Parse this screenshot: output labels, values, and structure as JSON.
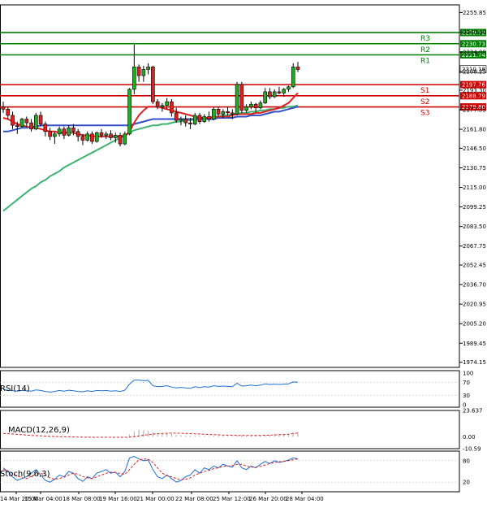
{
  "chart_data": {
    "type": "candlestick",
    "price_ticks": [
      "2255.85",
      "2240.10",
      "2224.00",
      "2208.25",
      "2193.30",
      "2177.55",
      "2161.80",
      "2146.50",
      "2130.75",
      "2115.00",
      "2099.25",
      "2083.50",
      "2067.75",
      "2052.45",
      "2036.70",
      "2020.95",
      "2005.20",
      "1989.45",
      "1974.15"
    ],
    "price_range": [
      1970,
      2262
    ],
    "x_labels": [
      "14 Mar 20:00",
      "15 Mar 04:00",
      "18 Mar 08:00",
      "19 Mar 16:00",
      "21 Mar 00:00",
      "22 Mar 08:00",
      "25 Mar 12:00",
      "26 Mar 20:00",
      "28 Mar 04:00"
    ],
    "levels": [
      {
        "name": "R3",
        "value": "2239.72",
        "color": "#008000"
      },
      {
        "name": "R2",
        "value": "2230.73",
        "color": "#008000"
      },
      {
        "name": "R1",
        "value": "2221.74",
        "color": "#008000"
      },
      {
        "name": "S1",
        "value": "2197.76",
        "color": "#cc0000"
      },
      {
        "name": "S2",
        "value": "2188.79",
        "color": "#cc0000"
      },
      {
        "name": "S3",
        "value": "2179.80",
        "color": "#cc0000"
      }
    ],
    "current_price": "2210.18",
    "candles": [
      [
        2180,
        2184,
        2175,
        2178
      ],
      [
        2178,
        2180,
        2170,
        2173
      ],
      [
        2173,
        2176,
        2162,
        2165
      ],
      [
        2165,
        2168,
        2158,
        2164
      ],
      [
        2164,
        2171,
        2163,
        2170
      ],
      [
        2170,
        2172,
        2164,
        2167
      ],
      [
        2167,
        2170,
        2160,
        2162
      ],
      [
        2162,
        2175,
        2161,
        2173
      ],
      [
        2173,
        2176,
        2164,
        2166
      ],
      [
        2166,
        2168,
        2156,
        2160
      ],
      [
        2160,
        2163,
        2153,
        2156
      ],
      [
        2156,
        2160,
        2150,
        2158
      ],
      [
        2158,
        2164,
        2156,
        2162
      ],
      [
        2162,
        2164,
        2154,
        2157
      ],
      [
        2157,
        2165,
        2156,
        2163
      ],
      [
        2163,
        2166,
        2157,
        2160
      ],
      [
        2160,
        2162,
        2152,
        2156
      ],
      [
        2156,
        2158,
        2149,
        2153
      ],
      [
        2153,
        2160,
        2152,
        2158
      ],
      [
        2158,
        2160,
        2150,
        2152
      ],
      [
        2152,
        2160,
        2151,
        2159
      ],
      [
        2159,
        2162,
        2155,
        2157
      ],
      [
        2157,
        2160,
        2154,
        2158
      ],
      [
        2158,
        2161,
        2153,
        2155
      ],
      [
        2155,
        2159,
        2151,
        2157
      ],
      [
        2157,
        2159,
        2148,
        2150
      ],
      [
        2150,
        2160,
        2149,
        2158
      ],
      [
        2158,
        2195,
        2157,
        2194
      ],
      [
        2194,
        2230,
        2190,
        2212
      ],
      [
        2212,
        2214,
        2200,
        2205
      ],
      [
        2205,
        2213,
        2200,
        2210
      ],
      [
        2210,
        2215,
        2206,
        2212
      ],
      [
        2212,
        2213,
        2182,
        2184
      ],
      [
        2184,
        2186,
        2178,
        2180
      ],
      [
        2180,
        2183,
        2176,
        2181
      ],
      [
        2181,
        2187,
        2178,
        2184
      ],
      [
        2184,
        2186,
        2172,
        2175
      ],
      [
        2175,
        2179,
        2167,
        2169
      ],
      [
        2169,
        2172,
        2165,
        2170
      ],
      [
        2170,
        2173,
        2164,
        2167
      ],
      [
        2167,
        2171,
        2162,
        2166
      ],
      [
        2166,
        2175,
        2165,
        2173
      ],
      [
        2173,
        2175,
        2166,
        2168
      ],
      [
        2168,
        2174,
        2167,
        2172
      ],
      [
        2172,
        2176,
        2168,
        2170
      ],
      [
        2170,
        2180,
        2169,
        2178
      ],
      [
        2178,
        2180,
        2172,
        2174
      ],
      [
        2174,
        2178,
        2171,
        2176
      ],
      [
        2176,
        2180,
        2173,
        2175
      ],
      [
        2175,
        2178,
        2170,
        2174
      ],
      [
        2174,
        2200,
        2173,
        2198
      ],
      [
        2198,
        2200,
        2175,
        2177
      ],
      [
        2177,
        2182,
        2175,
        2180
      ],
      [
        2180,
        2184,
        2178,
        2182
      ],
      [
        2182,
        2183,
        2176,
        2179
      ],
      [
        2179,
        2185,
        2178,
        2183
      ],
      [
        2183,
        2195,
        2182,
        2192
      ],
      [
        2192,
        2195,
        2186,
        2188
      ],
      [
        2188,
        2194,
        2187,
        2192
      ],
      [
        2192,
        2196,
        2190,
        2191
      ],
      [
        2191,
        2195,
        2188,
        2194
      ],
      [
        2194,
        2197,
        2192,
        2196
      ],
      [
        2196,
        2215,
        2195,
        2212
      ],
      [
        2212,
        2216,
        2208,
        2210
      ]
    ],
    "ma_fast": [
      2171,
      2170,
      2168,
      2166,
      2165,
      2164,
      2163,
      2163,
      2162,
      2161,
      2160,
      2160,
      2159,
      2159,
      2159,
      2159,
      2158,
      2157,
      2157,
      2156,
      2156,
      2156,
      2156,
      2156,
      2156,
      2156,
      2156,
      2160,
      2167,
      2173,
      2177,
      2180,
      2180,
      2180,
      2179,
      2178,
      2177,
      2176,
      2175,
      2174,
      2173,
      2172,
      2171,
      2171,
      2171,
      2172,
      2172,
      2172,
      2172,
      2173,
      2174,
      2174,
      2174,
      2174,
      2175,
      2175,
      2176,
      2177,
      2178,
      2179,
      2181,
      2183,
      2187,
      2191
    ],
    "ma_mid": [
      2160,
      2160,
      2161,
      2162,
      2163,
      2163,
      2164,
      2164,
      2165,
      2165,
      2165,
      2165,
      2165,
      2165,
      2165,
      2165,
      2165,
      2165,
      2165,
      2165,
      2165,
      2165,
      2165,
      2165,
      2165,
      2165,
      2165,
      2165,
      2166,
      2167,
      2168,
      2169,
      2170,
      2170,
      2170,
      2170,
      2170,
      2170,
      2170,
      2170,
      2170,
      2170,
      2170,
      2170,
      2170,
      2170,
      2171,
      2171,
      2171,
      2171,
      2172,
      2172,
      2172,
      2173,
      2173,
      2173,
      2174,
      2175,
      2176,
      2176,
      2177,
      2178,
      2179,
      2180
    ],
    "ma_slow": [
      2096,
      2099,
      2102,
      2105,
      2108,
      2111,
      2114,
      2116,
      2119,
      2121,
      2124,
      2126,
      2128,
      2131,
      2133,
      2135,
      2137,
      2139,
      2141,
      2143,
      2145,
      2147,
      2149,
      2151,
      2153,
      2155,
      2157,
      2159,
      2161,
      2162,
      2163,
      2164,
      2165,
      2165,
      2166,
      2166,
      2167,
      2168,
      2168,
      2169,
      2169,
      2170,
      2170,
      2171,
      2171,
      2172,
      2172,
      2173,
      2173,
      2174,
      2174,
      2175,
      2175,
      2176,
      2176,
      2177,
      2177,
      2178,
      2178,
      2179,
      2179,
      2180,
      2180,
      2181
    ],
    "rsi": {
      "label": "RSI(14)",
      "ticks": [
        "100",
        "70",
        "30",
        "0"
      ],
      "values": [
        48,
        46,
        44,
        43,
        45,
        44,
        43,
        47,
        45,
        42,
        40,
        42,
        45,
        43,
        46,
        44,
        42,
        41,
        44,
        42,
        45,
        44,
        45,
        43,
        44,
        42,
        46,
        65,
        78,
        78,
        76,
        77,
        60,
        57,
        58,
        60,
        56,
        53,
        55,
        53,
        52,
        57,
        54,
        57,
        56,
        60,
        58,
        59,
        58,
        57,
        68,
        59,
        60,
        62,
        60,
        62,
        66,
        64,
        65,
        64,
        65,
        66,
        72,
        71
      ]
    },
    "macd": {
      "label": "MACD(12,26,9)",
      "ticks": [
        "23.637",
        "0.00",
        "-10.59"
      ],
      "histogram": [
        0.5,
        0.3,
        0.1,
        -0.1,
        -0.2,
        -0.3,
        -0.3,
        -0.2,
        -0.2,
        -0.3,
        -0.4,
        -0.4,
        -0.3,
        -0.3,
        -0.2,
        -0.2,
        -0.3,
        -0.4,
        -0.3,
        -0.3,
        -0.2,
        -0.2,
        -0.2,
        -0.2,
        -0.2,
        -0.3,
        -0.2,
        2,
        5,
        6.5,
        6,
        5.5,
        4,
        3.5,
        3,
        3,
        2.5,
        2,
        1.5,
        1.2,
        1,
        1,
        0.8,
        0.8,
        0.7,
        0.9,
        0.8,
        0.8,
        0.7,
        0.7,
        1.5,
        1.3,
        1.2,
        1.3,
        1.2,
        1.4,
        2,
        2.2,
        2.4,
        2.5,
        2.6,
        2.8,
        4,
        4.4
      ],
      "signal": [
        3,
        2.8,
        2.5,
        2.2,
        1.9,
        1.6,
        1.3,
        1.1,
        0.9,
        0.7,
        0.5,
        0.3,
        0.2,
        0.1,
        0,
        -0.1,
        -0.2,
        -0.3,
        -0.3,
        -0.4,
        -0.4,
        -0.4,
        -0.4,
        -0.4,
        -0.4,
        -0.4,
        -0.4,
        -0.3,
        0.2,
        0.8,
        1.4,
        1.9,
        2.4,
        2.8,
        3,
        3.2,
        3.3,
        3.3,
        3.2,
        3.1,
        2.9,
        2.7,
        2.5,
        2.3,
        2.1,
        1.9,
        1.8,
        1.6,
        1.5,
        1.4,
        1.3,
        1.3,
        1.2,
        1.2,
        1.2,
        1.3,
        1.4,
        1.5,
        1.7,
        1.9,
        2.1,
        2.4,
        2.9,
        3.5
      ]
    },
    "stoch": {
      "label": "Stoch(9,6,3)",
      "ticks": [
        "80",
        "20"
      ],
      "main": [
        60,
        50,
        35,
        25,
        30,
        35,
        45,
        55,
        40,
        25,
        20,
        28,
        40,
        35,
        50,
        45,
        30,
        22,
        35,
        30,
        45,
        50,
        55,
        45,
        48,
        35,
        50,
        88,
        92,
        85,
        80,
        82,
        55,
        35,
        30,
        40,
        30,
        20,
        25,
        35,
        40,
        55,
        45,
        60,
        55,
        65,
        60,
        70,
        65,
        62,
        80,
        60,
        55,
        65,
        60,
        70,
        78,
        72,
        80,
        75,
        78,
        82,
        88,
        85
      ],
      "signal": [
        55,
        52,
        45,
        38,
        32,
        30,
        36,
        42,
        45,
        40,
        32,
        28,
        30,
        34,
        40,
        45,
        42,
        36,
        32,
        30,
        35,
        40,
        45,
        48,
        47,
        44,
        42,
        55,
        70,
        82,
        85,
        84,
        75,
        60,
        45,
        38,
        35,
        30,
        27,
        28,
        32,
        40,
        45,
        50,
        53,
        58,
        60,
        64,
        65,
        66,
        70,
        70,
        65,
        62,
        62,
        64,
        68,
        72,
        75,
        77,
        78,
        80,
        83,
        85
      ]
    }
  }
}
